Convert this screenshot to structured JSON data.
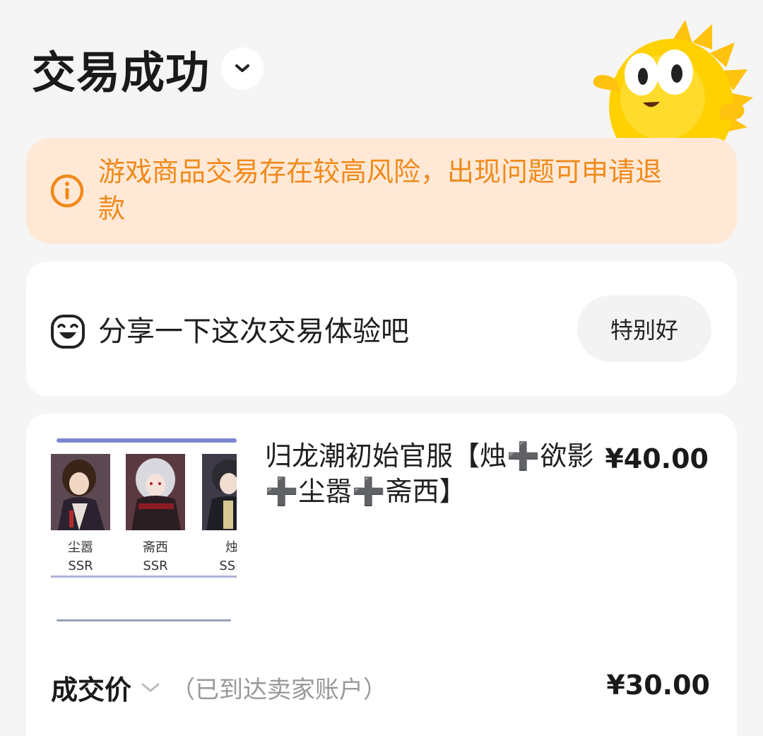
{
  "header": {
    "title": "交易成功",
    "toggle_icon": "chevron-down-icon"
  },
  "notice": {
    "icon": "info-circle-icon",
    "color": "#f08a1c",
    "background": "#ffe9d6",
    "text": "游戏商品交易存在较高风险，出现问题可申请退款"
  },
  "review": {
    "icon": "smile-face-icon",
    "prompt": "分享一下这次交易体验吧",
    "button_label": "特别好"
  },
  "order": {
    "thumbnail": {
      "characters": [
        {
          "name": "尘嚣",
          "rarity": "SSR"
        },
        {
          "name": "斋西",
          "rarity": "SSR"
        },
        {
          "name": "烛",
          "rarity": "SSR"
        }
      ]
    },
    "title": "归龙潮初始官服【烛➕欲影➕尘嚣➕斋西】",
    "price": "¥40.00",
    "deal": {
      "label": "成交价",
      "note": "（已到达卖家账户）",
      "price": "¥30.00"
    }
  }
}
